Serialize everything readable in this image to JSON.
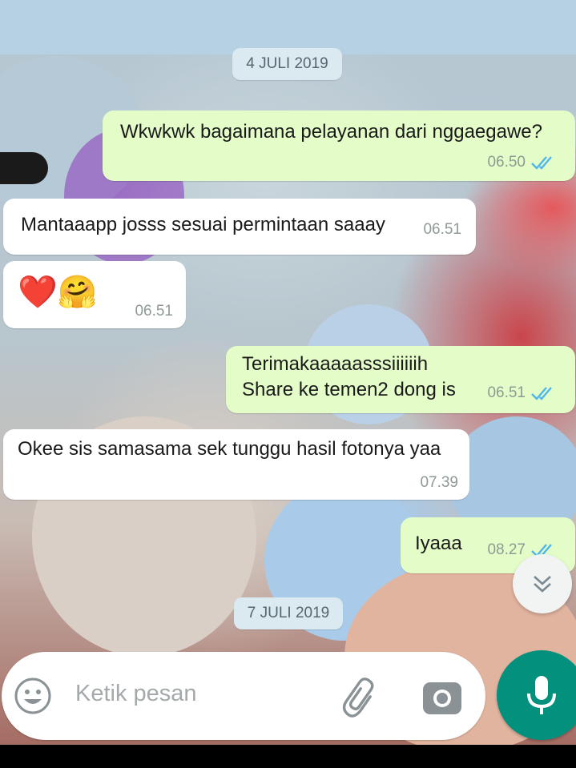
{
  "chat": {
    "dates": [
      "4 JULI 2019",
      "7 JULI 2019"
    ],
    "messages": [
      {
        "direction": "outgoing",
        "text": "Wkwkwk bagaimana pelayanan dari nggaegawe?",
        "time": "06.50",
        "status": "read"
      },
      {
        "direction": "incoming",
        "text": "Mantaaapp josss sesuai permintaan saaay",
        "time": "06.51"
      },
      {
        "direction": "incoming",
        "text": "❤️🤗",
        "time": "06.51"
      },
      {
        "direction": "outgoing",
        "lines": [
          "Terimakaaaaasssiiiiiih",
          "Share ke temen2 dong is"
        ],
        "time": "06.51",
        "status": "read"
      },
      {
        "direction": "incoming",
        "text": "Okee sis samasama sek tunggu hasil fotonya yaa",
        "time": "07.39"
      },
      {
        "direction": "outgoing",
        "text": "Iyaaa",
        "time": "08.27",
        "status": "read"
      }
    ]
  },
  "composer": {
    "placeholder": "Ketik pesan",
    "icons": [
      "emoji-icon",
      "attach-icon",
      "camera-icon",
      "mic-icon"
    ]
  },
  "scroll_button": {
    "icon": "double-chevron-down-icon"
  },
  "colors": {
    "outgoing_bubble": "#e3fcc8",
    "incoming_bubble": "#ffffff",
    "read_ticks": "#4fb6ec",
    "mic_button": "#03917e",
    "date_chip": "#dbeaf0"
  }
}
